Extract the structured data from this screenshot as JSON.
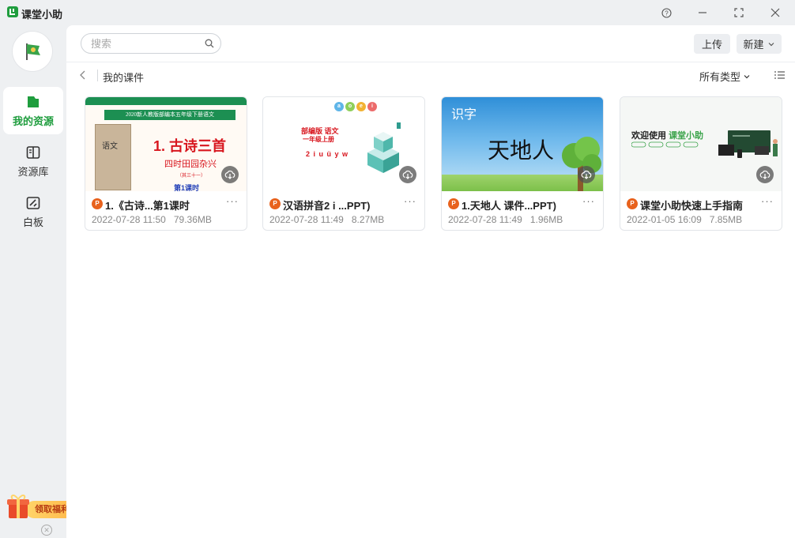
{
  "app": {
    "title": "课堂小助"
  },
  "window_controls": {
    "help": "?",
    "minimize": "—",
    "maximize": "⤢",
    "close": "✕"
  },
  "sidebar": {
    "items": [
      {
        "label": "我的资源",
        "icon": "folder-icon",
        "active": true
      },
      {
        "label": "资源库",
        "icon": "book-icon",
        "active": false
      },
      {
        "label": "白板",
        "icon": "whiteboard-icon",
        "active": false
      }
    ],
    "promo": {
      "label": "领取福利!"
    },
    "promo_close": "✕"
  },
  "toolbar": {
    "search_placeholder": "搜索",
    "upload_label": "上传",
    "new_label": "新建"
  },
  "breadcrumb": {
    "current": "我的课件"
  },
  "filter": {
    "type_label": "所有类型"
  },
  "colors": {
    "accent": "#1f9d3e",
    "ppt_badge": "#e8621d"
  },
  "files": [
    {
      "name": "1.《古诗...第1课时",
      "date": "2022-07-28 11:50",
      "size": "79.36MB",
      "badge": "P",
      "more": "···",
      "thumb": {
        "banner": "2020新人教版部编本五年级下册语文",
        "book_label": "语文",
        "title": "1. 古诗三首",
        "subtitle": "四时田园杂兴",
        "small": "（其三十一）",
        "footer": "第1课时"
      }
    },
    {
      "name": "汉语拼音2 i ...PPT)",
      "date": "2022-07-28 11:49",
      "size": "8.27MB",
      "badge": "P",
      "more": "···",
      "thumb": {
        "dots": [
          "a",
          "o",
          "e",
          "i"
        ],
        "line1": "部编版 语文",
        "line2": "一年级上册",
        "line3": "2 i u ü y w"
      }
    },
    {
      "name": "1.天地人 课件...PPT)",
      "date": "2022-07-28 11:49",
      "size": "1.96MB",
      "badge": "P",
      "more": "···",
      "thumb": {
        "corner": "识字",
        "title": "天地人"
      }
    },
    {
      "name": "课堂小助快速上手指南",
      "date": "2022-01-05 16:09",
      "size": "7.85MB",
      "badge": "P",
      "more": "···",
      "thumb": {
        "welcome": "欢迎使用",
        "brand": "课堂小助"
      }
    }
  ]
}
